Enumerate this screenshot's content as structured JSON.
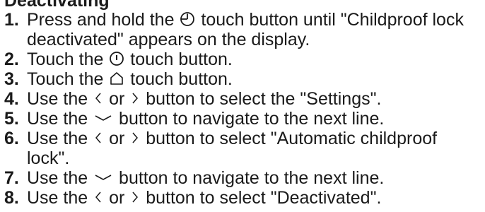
{
  "heading": "Deactivating",
  "steps": [
    {
      "n": "1.",
      "a": "Press and hold the ",
      "icon": "childproof-lock-icon",
      "b": " touch button until \"Childproof lock deactivated\" appears on the display."
    },
    {
      "n": "2.",
      "a": "Touch the ",
      "icon": "power-icon",
      "b": " touch button."
    },
    {
      "n": "3.",
      "a": "Touch the ",
      "icon": "home-icon",
      "b": " touch button."
    },
    {
      "n": "4.",
      "a": "Use the ",
      "icon": "left-right-arrows-icon",
      "b": " button to select the \"Settings\"."
    },
    {
      "n": "5.",
      "a": "Use the ",
      "icon": "chevron-down-icon",
      "b": " button to navigate to the next line."
    },
    {
      "n": "6.",
      "a": "Use the ",
      "icon": "left-right-arrows-icon",
      "b": " button to select \"Automatic childproof lock\"."
    },
    {
      "n": "7.",
      "a": "Use the ",
      "icon": "chevron-down-icon",
      "b": " button to navigate to the next line."
    },
    {
      "n": "8.",
      "a": "Use the ",
      "icon": "left-right-arrows-icon",
      "b": " button to select \"Deactivated\"."
    }
  ],
  "left_right_separator": "or"
}
